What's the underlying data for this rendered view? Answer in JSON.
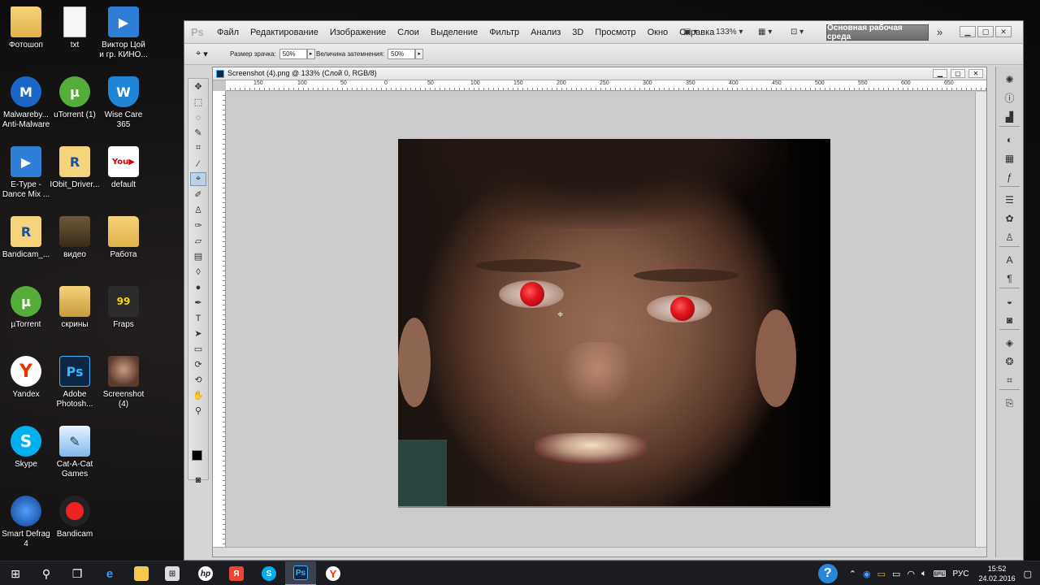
{
  "desktop": {
    "icons": [
      {
        "label": "Фотошоп",
        "icon": "folder-icon"
      },
      {
        "label": "txt",
        "icon": "text-file-icon"
      },
      {
        "label": "Виктор Цой\nи гр. КИНО...",
        "icon": "video-file-icon"
      },
      {
        "label": "Malwareby...\nAnti-Malware",
        "icon": "malwarebytes-icon"
      },
      {
        "label": "uTorrent (1)",
        "icon": "utorrent-icon"
      },
      {
        "label": "Wise Care\n365",
        "icon": "wise-care-icon"
      },
      {
        "label": "E-Type -\nDance Mix ...",
        "icon": "video-file-icon"
      },
      {
        "label": "IObit_Driver...",
        "icon": "iobit-icon"
      },
      {
        "label": "default",
        "icon": "youtube-icon"
      },
      {
        "label": "Bandicam_...",
        "icon": "bandicam-folder-icon"
      },
      {
        "label": "видео",
        "icon": "video-folder-icon"
      },
      {
        "label": "Работа",
        "icon": "folder-icon"
      },
      {
        "label": "µTorrent",
        "icon": "utorrent-icon"
      },
      {
        "label": "скрины",
        "icon": "screenshots-folder-icon"
      },
      {
        "label": "Fraps",
        "icon": "fraps-icon"
      },
      {
        "label": "Yandex",
        "icon": "yandex-browser-icon"
      },
      {
        "label": "Adobe\nPhotosh...",
        "icon": "photoshop-icon"
      },
      {
        "label": "Screenshot\n(4)",
        "icon": "image-thumbnail-icon"
      },
      {
        "label": "Skype",
        "icon": "skype-icon"
      },
      {
        "label": "Cat-A-Cat\nGames",
        "icon": "cat-a-cat-icon"
      },
      {
        "label": "Smart Defrag\n4",
        "icon": "smart-defrag-icon"
      },
      {
        "label": "Bandicam",
        "icon": "bandicam-icon"
      }
    ]
  },
  "photoshop": {
    "logo": "Ps",
    "menu": [
      "Файл",
      "Редактирование",
      "Изображение",
      "Слои",
      "Выделение",
      "Фильтр",
      "Анализ",
      "3D",
      "Просмотр",
      "Окно",
      "Справка"
    ],
    "zoom": "133%",
    "workspace": "Основная рабочая среда",
    "options": {
      "pupil_size_label": "Размер зрачка:",
      "pupil_size_value": "50%",
      "darken_label": "Величина затемнения:",
      "darken_value": "50%"
    },
    "document": {
      "title": "Screenshot (4).png @ 133% (Слой 0, RGB/8)",
      "ruler_top": [
        "150",
        "100",
        "50",
        "0",
        "50",
        "100",
        "150",
        "200",
        "250",
        "300",
        "350",
        "400",
        "450",
        "500",
        "550",
        "600",
        "650"
      ]
    },
    "active_tool": "red-eye-tool"
  },
  "taskbar": {
    "lang": "РУС",
    "time": "15:52",
    "date": "24.02.2016",
    "help": "?"
  },
  "colors": {
    "taskbar": "#1b1c22",
    "ps_chrome": "#d6d6d6",
    "red_eye": "#e0161e"
  }
}
